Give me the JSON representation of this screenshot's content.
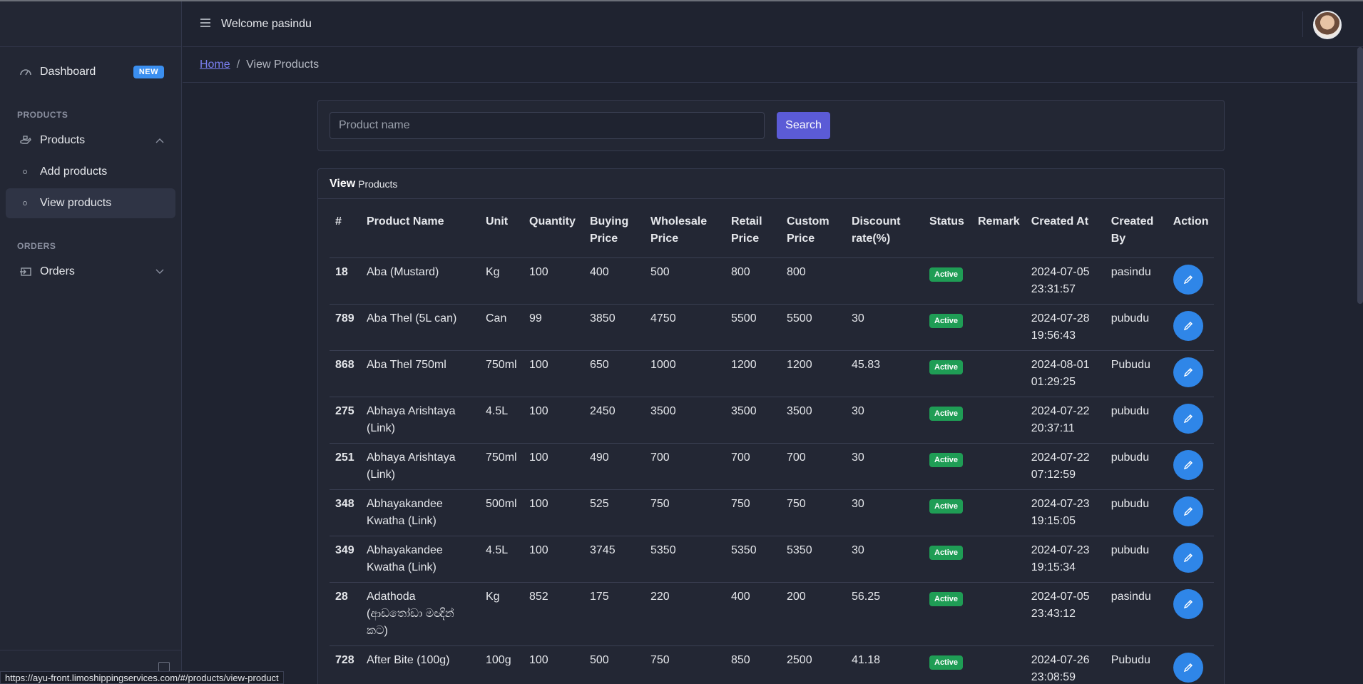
{
  "header": {
    "welcome": "Welcome pasindu"
  },
  "sidebar": {
    "dashboard": {
      "label": "Dashboard",
      "badge": "NEW"
    },
    "sections": {
      "products": "PRODUCTS",
      "orders": "ORDERS"
    },
    "products": {
      "label": "Products",
      "sub": [
        "Add products",
        "View products"
      ]
    },
    "orders": {
      "label": "Orders"
    }
  },
  "breadcrumb": {
    "home": "Home",
    "current": "View Products"
  },
  "search": {
    "placeholder": "Product name",
    "button": "Search"
  },
  "table_card": {
    "title_bold": "View",
    "title_rest": "Products"
  },
  "table": {
    "columns": [
      "#",
      "Product Name",
      "Unit",
      "Quantity",
      "Buying Price",
      "Wholesale Price",
      "Retail Price",
      "Custom Price",
      "Discount rate(%)",
      "Status",
      "Remark",
      "Created At",
      "Created By",
      "Action"
    ],
    "rows": [
      {
        "id": "18",
        "name": "Aba (Mustard)",
        "unit": "Kg",
        "qty": "100",
        "buy": "400",
        "wholesale": "500",
        "retail": "800",
        "custom": "800",
        "discount": "",
        "status": "Active",
        "remark": "",
        "created_at": "2024-07-05 23:31:57",
        "created_by": "pasindu"
      },
      {
        "id": "789",
        "name": "Aba Thel (5L can)",
        "unit": "Can",
        "qty": "99",
        "buy": "3850",
        "wholesale": "4750",
        "retail": "5500",
        "custom": "5500",
        "discount": "30",
        "status": "Active",
        "remark": "",
        "created_at": "2024-07-28 19:56:43",
        "created_by": "pubudu"
      },
      {
        "id": "868",
        "name": "Aba Thel 750ml",
        "unit": "750ml",
        "qty": "100",
        "buy": "650",
        "wholesale": "1000",
        "retail": "1200",
        "custom": "1200",
        "discount": "45.83",
        "status": "Active",
        "remark": "",
        "created_at": "2024-08-01 01:29:25",
        "created_by": "Pubudu"
      },
      {
        "id": "275",
        "name": "Abhaya Arishtaya (Link)",
        "unit": "4.5L",
        "qty": "100",
        "buy": "2450",
        "wholesale": "3500",
        "retail": "3500",
        "custom": "3500",
        "discount": "30",
        "status": "Active",
        "remark": "",
        "created_at": "2024-07-22 20:37:11",
        "created_by": "pubudu"
      },
      {
        "id": "251",
        "name": "Abhaya Arishtaya (Link)",
        "unit": "750ml",
        "qty": "100",
        "buy": "490",
        "wholesale": "700",
        "retail": "700",
        "custom": "700",
        "discount": "30",
        "status": "Active",
        "remark": "",
        "created_at": "2024-07-22 07:12:59",
        "created_by": "pubudu"
      },
      {
        "id": "348",
        "name": "Abhayakandee Kwatha (Link)",
        "unit": "500ml",
        "qty": "100",
        "buy": "525",
        "wholesale": "750",
        "retail": "750",
        "custom": "750",
        "discount": "30",
        "status": "Active",
        "remark": "",
        "created_at": "2024-07-23 19:15:05",
        "created_by": "pubudu"
      },
      {
        "id": "349",
        "name": "Abhayakandee Kwatha (Link)",
        "unit": "4.5L",
        "qty": "100",
        "buy": "3745",
        "wholesale": "5350",
        "retail": "5350",
        "custom": "5350",
        "discount": "30",
        "status": "Active",
        "remark": "",
        "created_at": "2024-07-23 19:15:34",
        "created_by": "pubudu"
      },
      {
        "id": "28",
        "name": "Adathoda (ආඩතෝඩා මඥින් කට)",
        "unit": "Kg",
        "qty": "852",
        "buy": "175",
        "wholesale": "220",
        "retail": "400",
        "custom": "200",
        "discount": "56.25",
        "status": "Active",
        "remark": "",
        "created_at": "2024-07-05 23:43:12",
        "created_by": "pasindu"
      },
      {
        "id": "728",
        "name": "After Bite (100g)",
        "unit": "100g",
        "qty": "100",
        "buy": "500",
        "wholesale": "750",
        "retail": "850",
        "custom": "2500",
        "discount": "41.18",
        "status": "Active",
        "remark": "",
        "created_at": "2024-07-26 23:08:59",
        "created_by": "Pubudu"
      }
    ]
  },
  "status_url": "https://ayu-front.limoshippingservices.com/#/products/view-product",
  "colors": {
    "accent": "#5b5bd6",
    "status_active": "#1f9d55",
    "edit": "#2f86e8",
    "badge": "#3b8ff0"
  }
}
